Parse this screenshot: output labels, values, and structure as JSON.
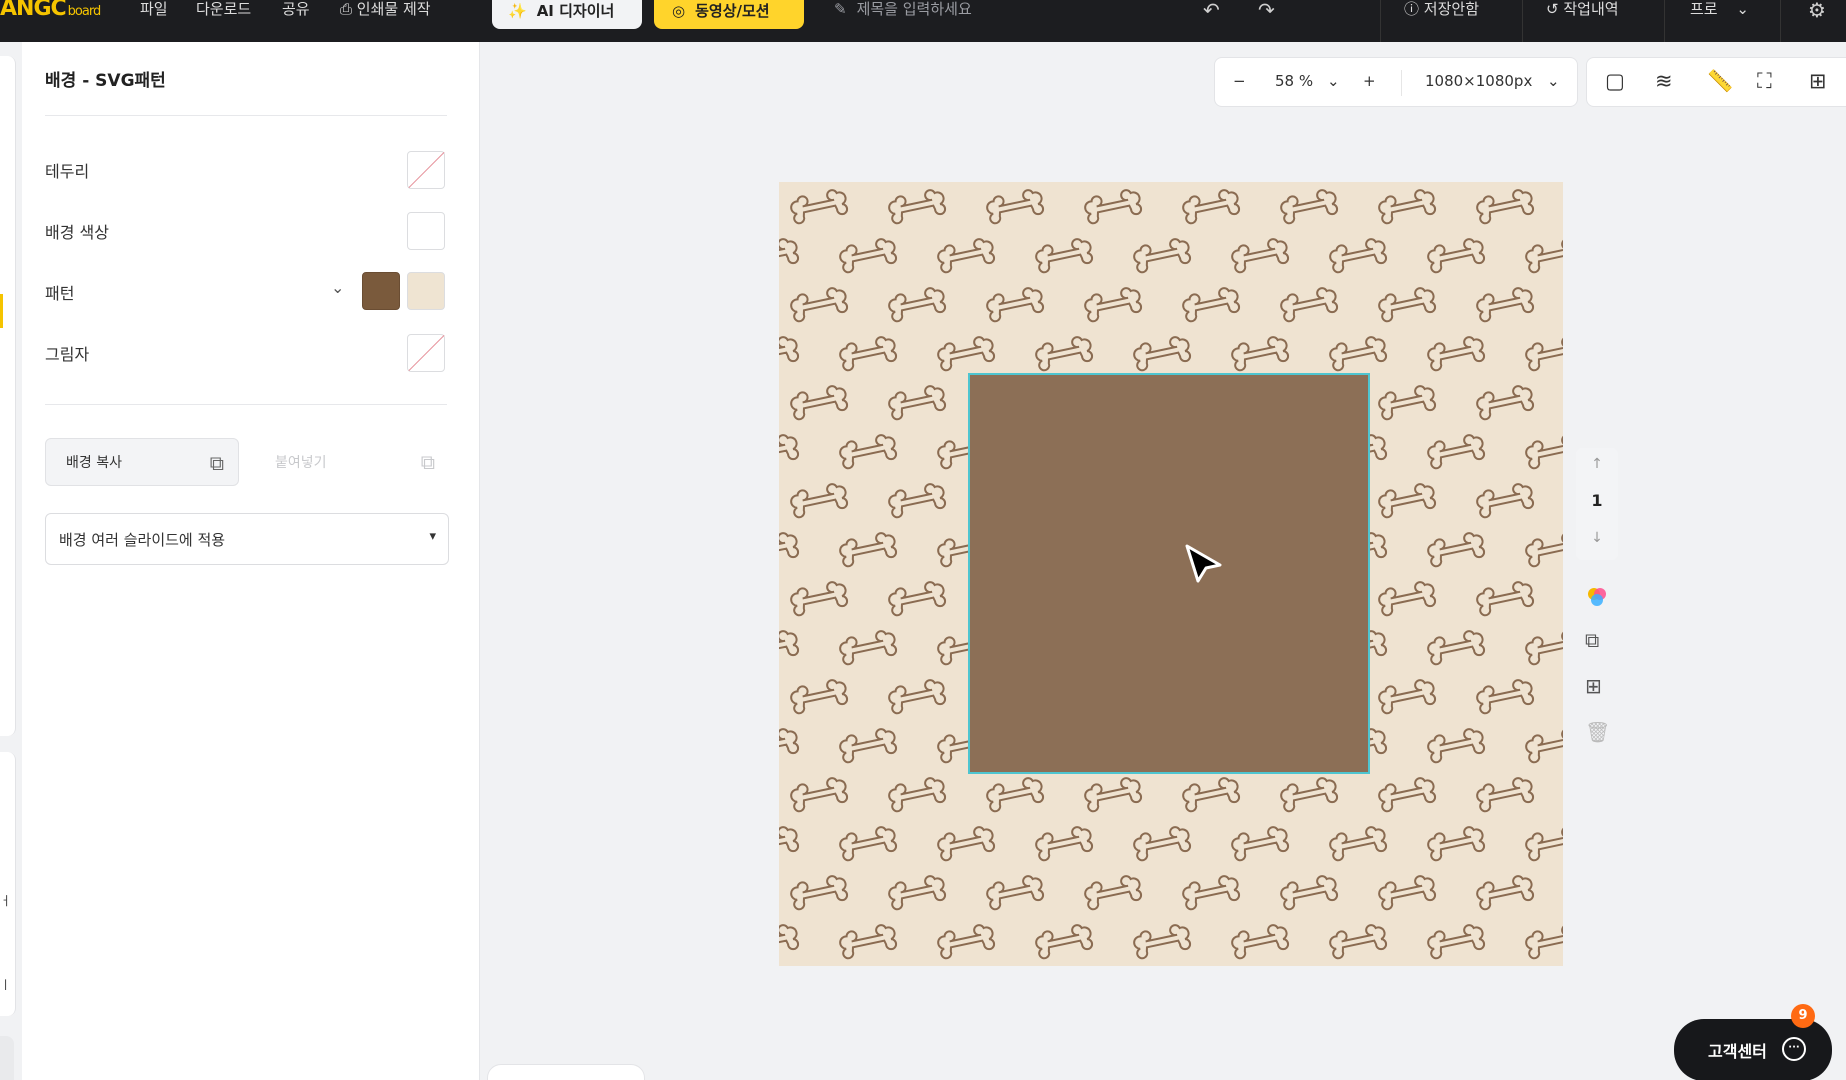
{
  "brand": {
    "logo_main": "ANGC",
    "logo_sub": "board",
    "accent": "#f5c400"
  },
  "topbar": {
    "menu": [
      "파일",
      "다운로드",
      "공유",
      "인쇄물 제작"
    ],
    "ai_designer_label": "AI 디자이너",
    "video_motion_label": "동영상/모션",
    "title_placeholder": "제목을 입력하세요",
    "save_guide_label": "저장안함",
    "history_label": "작업내역",
    "pro_label": "프로"
  },
  "panel": {
    "title": "배경 - SVG패턴",
    "props": {
      "border_label": "테두리",
      "bg_color_label": "배경 색상",
      "pattern_label": "패턴",
      "shadow_label": "그림자"
    },
    "pattern_colors": {
      "primary": "#7a5a3c",
      "secondary": "#efe4d2"
    },
    "copy_bg_label": "배경 복사",
    "paste_label": "붙여넣기",
    "apply_select_label": "배경 여러 슬라이드에 적용"
  },
  "zoom": {
    "value": "58 %",
    "canvas_size": "1080×1080px"
  },
  "canvas": {
    "bg_color": "#efe3d1",
    "shape_color": "#8c6f56",
    "selection_color": "#4ec5d0"
  },
  "pages": {
    "current": "1"
  },
  "support": {
    "label": "고객센터",
    "badge_count": "9"
  }
}
